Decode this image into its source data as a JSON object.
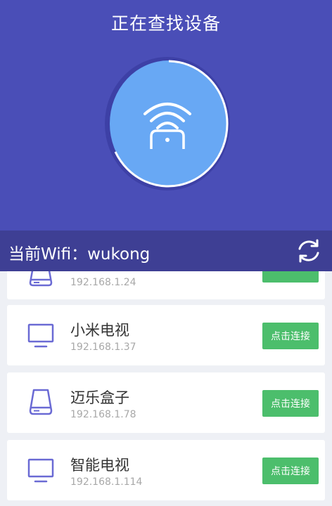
{
  "header": {
    "title": "正在查找设备"
  },
  "wifi_bar": {
    "label": "当前Wifi：wukong"
  },
  "devices": [
    {
      "name": "",
      "ip": "192.168.1.24",
      "icon": "box-icon",
      "button_label": ""
    },
    {
      "name": "小米电视",
      "ip": "192.168.1.37",
      "icon": "tv-icon",
      "button_label": "点击连接"
    },
    {
      "name": "迈乐盒子",
      "ip": "192.168.1.78",
      "icon": "box-icon",
      "button_label": "点击连接"
    },
    {
      "name": "智能电视",
      "ip": "192.168.1.114",
      "icon": "tv-icon",
      "button_label": "点击连接"
    }
  ],
  "colors": {
    "header_bg": "#4a4eb7",
    "wifi_bar_bg": "#3e3f94",
    "scan_circle": "#68a8f4",
    "accent_button": "#4cbe6c",
    "icon_purple": "#6a6ad4"
  }
}
